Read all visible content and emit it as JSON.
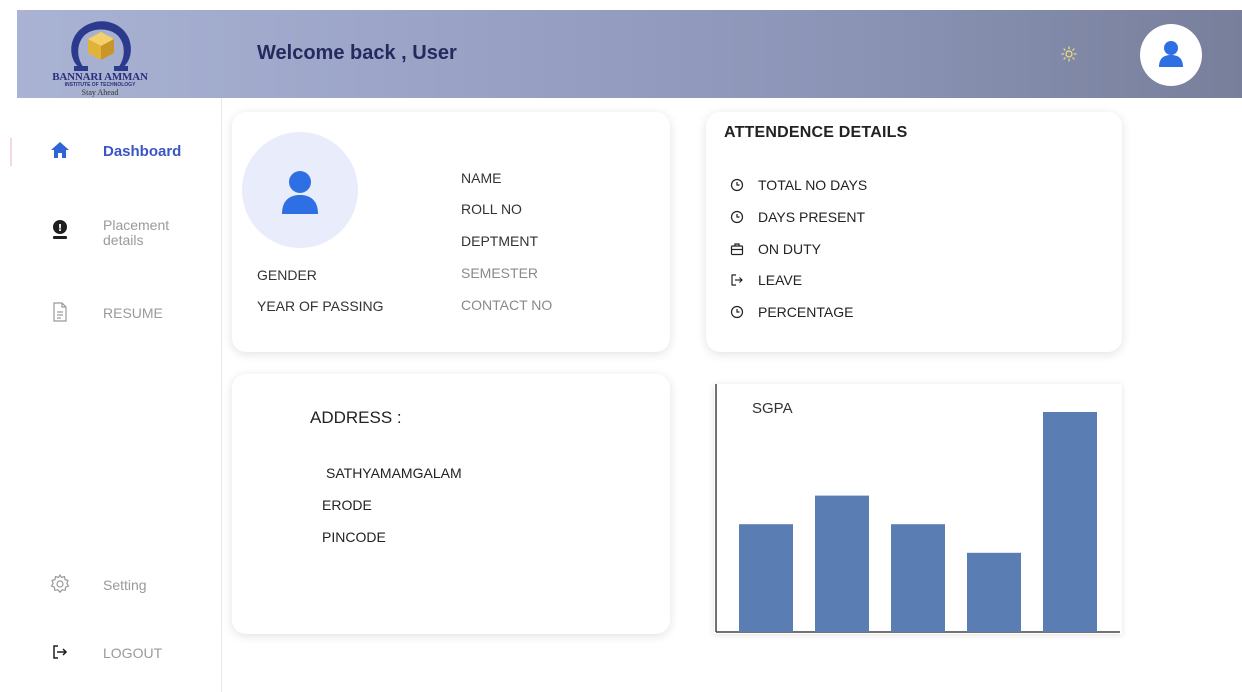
{
  "header": {
    "logo": {
      "name": "BANNARI AMMAN",
      "subtitle": "INSTITUTE OF TECHNOLOGY",
      "tagline": "Stay Ahead"
    },
    "welcome_text": "Welcome back , User",
    "theme_icon": "sun-icon",
    "avatar_icon": "user-icon"
  },
  "sidebar": {
    "items": [
      {
        "label": "Dashboard",
        "icon": "home-icon",
        "active": true
      },
      {
        "label": "Placement\ndetails",
        "icon": "placement-icon",
        "active": false
      },
      {
        "label": "RESUME",
        "icon": "document-icon",
        "active": false
      },
      {
        "label": "Setting",
        "icon": "gear-icon",
        "active": false
      },
      {
        "label": "LOGOUT",
        "icon": "logout-icon",
        "active": false
      }
    ]
  },
  "profile": {
    "fields_right": [
      "NAME",
      "ROLL NO",
      "DEPTMENT",
      "SEMESTER",
      "CONTACT NO"
    ],
    "fields_left": [
      "GENDER",
      "YEAR OF PASSING"
    ]
  },
  "attendance": {
    "title": "ATTENDENCE DETAILS",
    "items": [
      {
        "label": "TOTAL NO DAYS",
        "icon": "clock-icon"
      },
      {
        "label": "DAYS PRESENT",
        "icon": "clock-icon"
      },
      {
        "label": "ON DUTY",
        "icon": "briefcase-icon"
      },
      {
        "label": "LEAVE",
        "icon": "exit-icon"
      },
      {
        "label": "PERCENTAGE",
        "icon": "clock-icon"
      }
    ]
  },
  "address": {
    "title": "ADDRESS :",
    "lines": [
      "SATHYAMAMGALAM",
      "ERODE",
      "PINCODE"
    ]
  },
  "chart_data": {
    "type": "bar",
    "title": "SGPA",
    "categories": [
      "",
      "",
      "",
      "",
      ""
    ],
    "values": [
      4.9,
      6.2,
      4.9,
      3.6,
      10
    ],
    "ylim": [
      0,
      11
    ],
    "color": "#5a7db3",
    "grid": false
  },
  "colors": {
    "accent": "#3b55c7",
    "icon_blue": "#2f6fe4",
    "bar": "#5a7db3"
  }
}
